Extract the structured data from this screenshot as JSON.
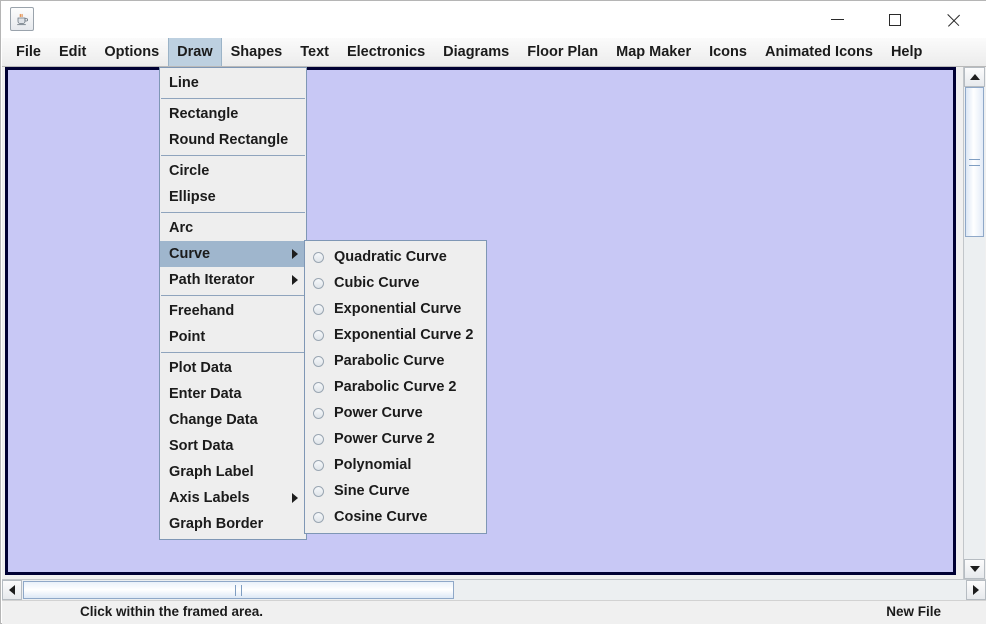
{
  "window": {
    "app_icon": "java-coffee-cup-icon",
    "controls": {
      "minimize": "minimize-icon",
      "maximize": "maximize-icon",
      "close": "close-icon"
    }
  },
  "menubar": {
    "items": [
      {
        "label": "File",
        "active": false
      },
      {
        "label": "Edit",
        "active": false
      },
      {
        "label": "Options",
        "active": false
      },
      {
        "label": "Draw",
        "active": true
      },
      {
        "label": "Shapes",
        "active": false
      },
      {
        "label": "Text",
        "active": false
      },
      {
        "label": "Electronics",
        "active": false
      },
      {
        "label": "Diagrams",
        "active": false
      },
      {
        "label": "Floor Plan",
        "active": false
      },
      {
        "label": "Map Maker",
        "active": false
      },
      {
        "label": "Icons",
        "active": false
      },
      {
        "label": "Animated Icons",
        "active": false
      },
      {
        "label": "Help",
        "active": false
      }
    ]
  },
  "draw_menu": {
    "groups": [
      {
        "items": [
          {
            "label": "Line",
            "submenu": false,
            "selected": false
          }
        ]
      },
      {
        "items": [
          {
            "label": "Rectangle",
            "submenu": false,
            "selected": false
          },
          {
            "label": "Round Rectangle",
            "submenu": false,
            "selected": false
          }
        ]
      },
      {
        "items": [
          {
            "label": "Circle",
            "submenu": false,
            "selected": false
          },
          {
            "label": "Ellipse",
            "submenu": false,
            "selected": false
          }
        ]
      },
      {
        "items": [
          {
            "label": "Arc",
            "submenu": false,
            "selected": false
          },
          {
            "label": "Curve",
            "submenu": true,
            "selected": true
          },
          {
            "label": "Path Iterator",
            "submenu": true,
            "selected": false
          }
        ]
      },
      {
        "items": [
          {
            "label": "Freehand",
            "submenu": false,
            "selected": false
          },
          {
            "label": "Point",
            "submenu": false,
            "selected": false
          }
        ]
      },
      {
        "items": [
          {
            "label": "Plot Data",
            "submenu": false,
            "selected": false
          },
          {
            "label": "Enter Data",
            "submenu": false,
            "selected": false
          },
          {
            "label": "Change Data",
            "submenu": false,
            "selected": false
          },
          {
            "label": "Sort Data",
            "submenu": false,
            "selected": false
          },
          {
            "label": "Graph Label",
            "submenu": false,
            "selected": false
          },
          {
            "label": "Axis Labels",
            "submenu": true,
            "selected": false
          },
          {
            "label": "Graph Border",
            "submenu": false,
            "selected": false
          }
        ]
      }
    ]
  },
  "curve_submenu": {
    "items": [
      {
        "label": "Quadratic Curve",
        "checked": false
      },
      {
        "label": "Cubic Curve",
        "checked": false
      },
      {
        "label": "Exponential Curve",
        "checked": false
      },
      {
        "label": "Exponential Curve 2",
        "checked": false
      },
      {
        "label": "Parabolic Curve",
        "checked": false
      },
      {
        "label": "Parabolic Curve 2",
        "checked": false
      },
      {
        "label": "Power Curve",
        "checked": false
      },
      {
        "label": "Power Curve 2",
        "checked": false
      },
      {
        "label": "Polynomial",
        "checked": false
      },
      {
        "label": "Sine Curve",
        "checked": false
      },
      {
        "label": "Cosine Curve",
        "checked": false
      }
    ]
  },
  "canvas": {
    "background_color": "#c8c8f5",
    "border_color": "#000033"
  },
  "scrollbars": {
    "vertical": {
      "up": "scroll-up-icon",
      "down": "scroll-down-icon"
    },
    "horizontal": {
      "left": "scroll-left-icon",
      "right": "scroll-right-icon"
    }
  },
  "statusbar": {
    "message": "Click within the framed area.",
    "file_status": "New File"
  }
}
